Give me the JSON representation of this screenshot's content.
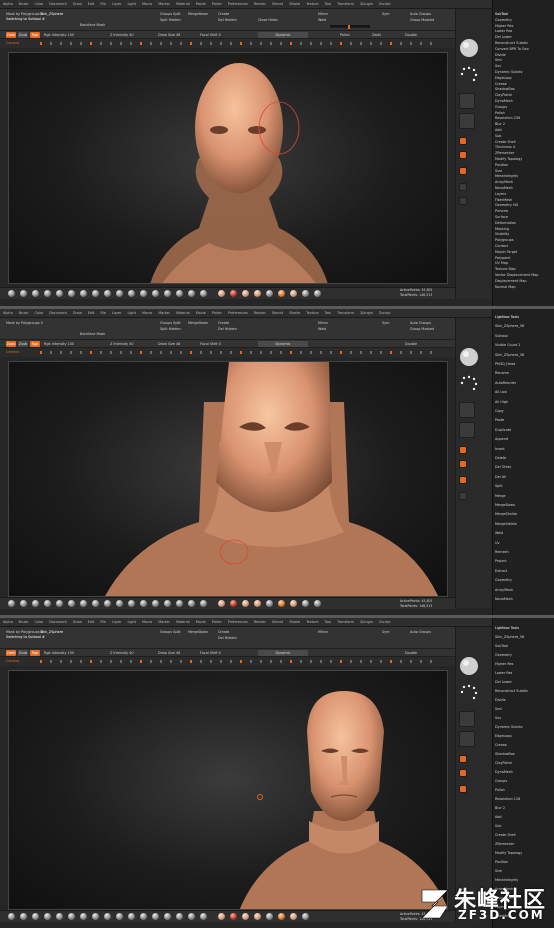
{
  "menu": [
    "Alpha",
    "Brush",
    "Color",
    "Document",
    "Draw",
    "Edit",
    "File",
    "Layer",
    "Light",
    "Macro",
    "Marker",
    "Material",
    "Movie",
    "Picker",
    "Preferences",
    "Render",
    "Stencil",
    "Stroke",
    "Texture",
    "Tool",
    "Transform",
    "Zplugin",
    "Zscript"
  ],
  "toolbar": {
    "switch_label": "Switching to Subtool #",
    "tool_name": "Skin_ZSphere",
    "mask_label": "Mask by Polygroups 0",
    "zadd": "Zadd",
    "zsub": "Zsub",
    "rgb": "Rgb",
    "mrgb": "Mrgb",
    "m": "M",
    "rgb_intensity": "Rgb Intensity 100",
    "z_intensity": "Z Intensity 40",
    "draw_size": "Draw Size 48",
    "focal_shift": "Focal Shift 0",
    "dynamic": "Dynamic",
    "backface": "Backface Mask",
    "groups_split": "Groups Split",
    "merge_down": "MergeDown",
    "split_hidden": "Split Hidden",
    "create": "Create",
    "del_hidden": "Del Hidden",
    "close_holes": "Close Holes",
    "mirror": "Mirror",
    "weld": "Weld",
    "sym": "Sym",
    "auto_groups": "Auto Groups",
    "group_masked": "Group Masked",
    "polish": "Polish",
    "dots": "Dots",
    "zadd2": "Zadd",
    "double": "Double",
    "camera": "Camera"
  },
  "shelf": {
    "brush_icon": "sphere-brush-icon"
  },
  "stats": [
    {
      "active_points": "ActivePoints: 45,801",
      "total_points": "TotalPoints: 146,513"
    },
    {
      "active_points": "ActivePoints: 45,801",
      "total_points": "TotalPoints: 146,513"
    },
    {
      "active_points": "ActivePoints: 45,801",
      "total_points": "TotalPoints: 146,513"
    }
  ],
  "tray": {
    "panel1": [
      "SubTool",
      "Geometry",
      "Higher Res",
      "Lower Res",
      "Del Lower",
      "Reconstruct Subdiv",
      "Convert BPR To Geo",
      "Divide",
      "Smt",
      "Suv",
      "Dynamic Subdiv",
      "EdgeLoop",
      "Crease",
      "ShadowBox",
      "ClayPolish",
      "DynaMesh",
      "Groups",
      "Polish",
      "Resolution 256",
      "Blur 2",
      "Add",
      "Sub",
      "Create Shell",
      "Thickness 4",
      "ZRemesher",
      "Modify Topology",
      "Position",
      "Size",
      "MeshIntegrity",
      "ArrayMesh",
      "NanoMesh",
      "Layers",
      "FiberMesh",
      "Geometry HD",
      "Preview",
      "Surface",
      "Deformation",
      "Masking",
      "Visibility",
      "Polygroups",
      "Contact",
      "Morph Target",
      "Polypaint",
      "UV Map",
      "Texture Map",
      "Vector Displacement Map",
      "Displacement Map",
      "Normal Map"
    ],
    "panel2": [
      "Lightbox Tools",
      "Skin_ZSphere_58",
      "Subtool",
      "Visible Count 2",
      "Skin_ZSphere_58",
      "PM3D_Head",
      "Rename",
      "AutoReorder",
      "All Low",
      "All High",
      "Copy",
      "Paste",
      "Duplicate",
      "Append",
      "Insert",
      "Delete",
      "Del Other",
      "Del All",
      "Split",
      "Merge",
      "MergeDown",
      "MergeSimilar",
      "MergeVisible",
      "Weld",
      "Uv",
      "Remesh",
      "Project",
      "Extract",
      "Geometry",
      "ArrayMesh",
      "NanoMesh"
    ],
    "panel3": [
      "Lightbox Tools",
      "Skin_ZSphere_58",
      "SubTool",
      "Geometry",
      "Higher Res",
      "Lower Res",
      "Del Lower",
      "Reconstruct Subdiv",
      "Divide",
      "Smt",
      "Suv",
      "Dynamic Subdiv",
      "EdgeLoop",
      "Crease",
      "ShadowBox",
      "ClayPolish",
      "DynaMesh",
      "Groups",
      "Polish",
      "Resolution 128",
      "Blur 2",
      "Add",
      "Sub",
      "Create Shell",
      "ZRemesher",
      "Modify Topology",
      "Position",
      "Size",
      "MeshIntegrity",
      "ArrayMesh",
      "NanoMesh",
      "Layers",
      "FiberMesh"
    ]
  },
  "watermark": {
    "brand": "朱峰社区",
    "domain": "ZF3D.COM"
  },
  "colors": {
    "accent": "#e3691f",
    "skin": "#e0a27c",
    "background": "#262626"
  }
}
